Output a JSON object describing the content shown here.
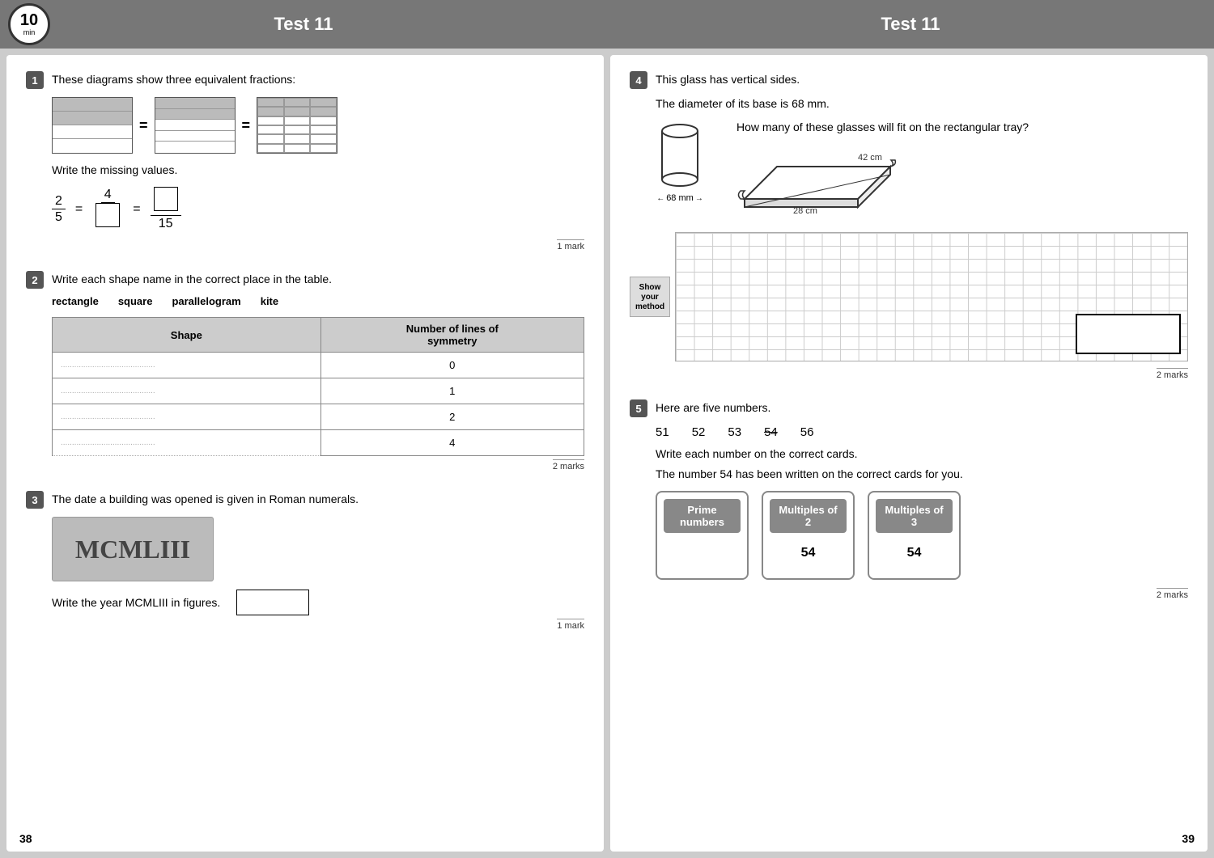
{
  "header": {
    "title_left": "Test 11",
    "title_right": "Test 11",
    "timer": "10",
    "timer_unit": "min"
  },
  "left_page": {
    "page_number": "38",
    "q1": {
      "number": "1",
      "text": "These diagrams show three equivalent fractions:",
      "instruction": "Write the missing values.",
      "fraction_eq": "2/5 = 4/? = ?/15",
      "marks": "1 mark"
    },
    "q2": {
      "number": "2",
      "text": "Write each shape name in the correct place in the table.",
      "shapes": [
        "rectangle",
        "square",
        "parallelogram",
        "kite"
      ],
      "table_headers": [
        "Shape",
        "Number of lines of symmetry"
      ],
      "table_rows": [
        {
          "shape": "..........................................",
          "symmetry": "0"
        },
        {
          "shape": "..........................................",
          "symmetry": "1"
        },
        {
          "shape": "..........................................",
          "symmetry": "2"
        },
        {
          "shape": "..........................................",
          "symmetry": "4"
        }
      ],
      "marks": "2 marks"
    },
    "q3": {
      "number": "3",
      "text": "The date a building was opened is given in Roman numerals.",
      "roman_numeral": "MCMLIII",
      "instruction": "Write the year MCMLIII in figures.",
      "marks": "1 mark"
    }
  },
  "right_page": {
    "page_number": "39",
    "q4": {
      "number": "4",
      "text": "This glass has vertical sides.",
      "subtext": "The diameter of its base is 68 mm.",
      "dimension_label": "68 mm",
      "tray_dimensions": "28 cm × 42 cm",
      "tray_dim_left": "28 cm",
      "tray_dim_right": "42 cm",
      "question": "How many of these glasses will fit on the rectangular tray?",
      "show_method": "Show your method",
      "marks": "2 marks"
    },
    "q5": {
      "number": "5",
      "text": "Here are five numbers.",
      "numbers": [
        "51",
        "52",
        "53",
        "54",
        "56"
      ],
      "crossed_number": "54",
      "instruction1": "Write each number on the correct cards.",
      "instruction2": "The number 54 has been written on the correct cards for you.",
      "cards": [
        {
          "header": "Prime numbers",
          "value": ""
        },
        {
          "header": "Multiples of 2",
          "value": "54"
        },
        {
          "header": "Multiples of 3",
          "value": "54"
        }
      ],
      "marks": "2 marks"
    }
  }
}
